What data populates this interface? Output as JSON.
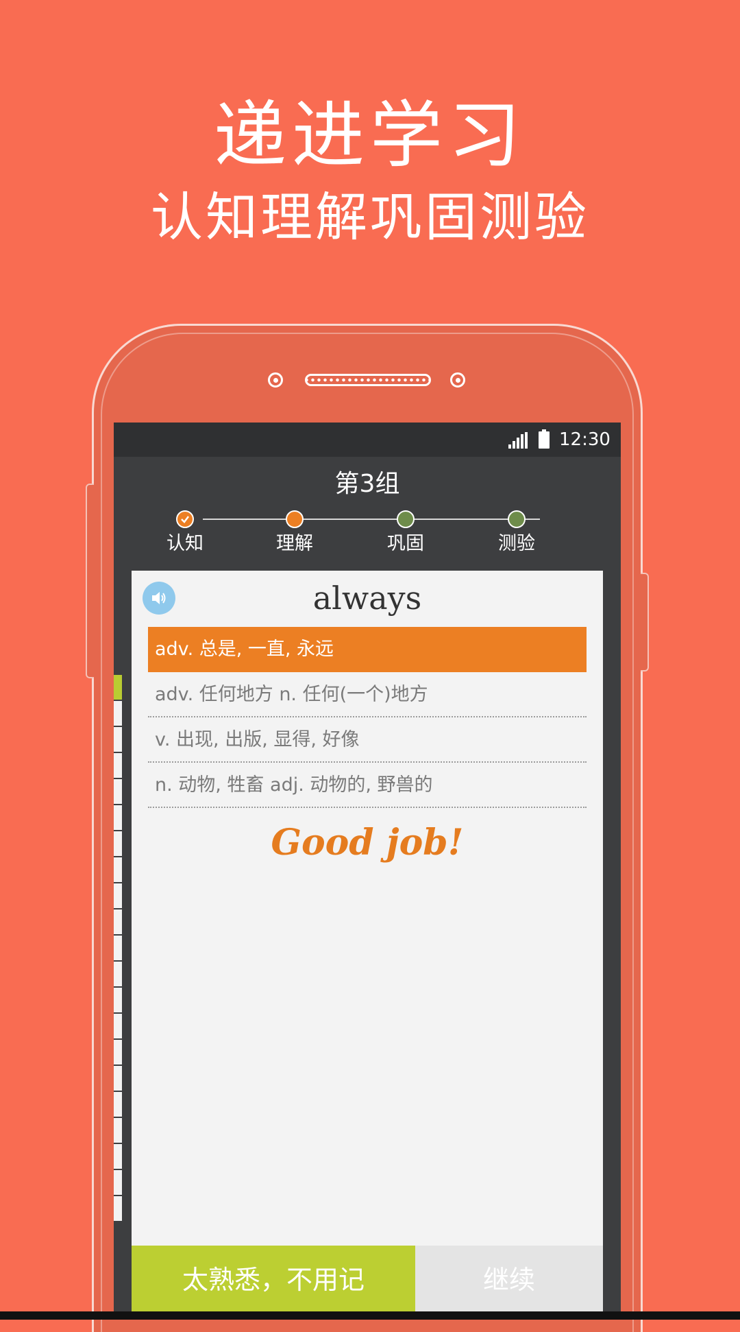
{
  "promo": {
    "title": "递进学习",
    "subtitle": "认知理解巩固测验"
  },
  "statusbar": {
    "time": "12:30",
    "icons": [
      "signal-icon",
      "battery-icon"
    ]
  },
  "group_title": "第3组",
  "steps": [
    {
      "label": "认知",
      "state": "done",
      "color": "#EC7F23"
    },
    {
      "label": "理解",
      "state": "current",
      "color": "#EC7F23"
    },
    {
      "label": "巩固",
      "state": "pending",
      "color": "#6E8C4A"
    },
    {
      "label": "测验",
      "state": "pending",
      "color": "#6E8C4A"
    }
  ],
  "card": {
    "word": "always",
    "options": [
      {
        "text": "adv. 总是, 一直, 永远",
        "selected": true
      },
      {
        "text": "adv. 任何地方 n. 任何(一个)地方",
        "selected": false
      },
      {
        "text": "v. 出现, 出版, 显得, 好像",
        "selected": false
      },
      {
        "text": "n. 动物, 牲畜 adj. 动物的, 野兽的",
        "selected": false
      }
    ],
    "feedback": "Good job!"
  },
  "buttons": {
    "known_label": "太熟悉，不用记",
    "continue_label": "继续"
  },
  "colors": {
    "background": "#F96C52",
    "accent_orange": "#EC7F23",
    "accent_green": "#BCCF32"
  }
}
